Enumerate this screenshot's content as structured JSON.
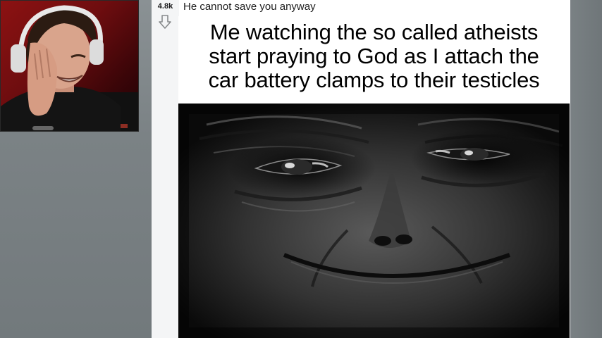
{
  "post": {
    "vote_count": "4.8k",
    "downvote_icon": "arrow-down-outline-icon",
    "title": "He cannot save you anyway",
    "meme_caption": {
      "line1": "Me watching the so called atheists",
      "line2": "start praying to God as I attach the",
      "line3": "car battery clamps to their testicles"
    }
  },
  "colors": {
    "page_background": "#7d8487",
    "post_background": "#ffffff",
    "vote_column": "#f4f5f6",
    "webcam_wall": "#8c1212"
  }
}
